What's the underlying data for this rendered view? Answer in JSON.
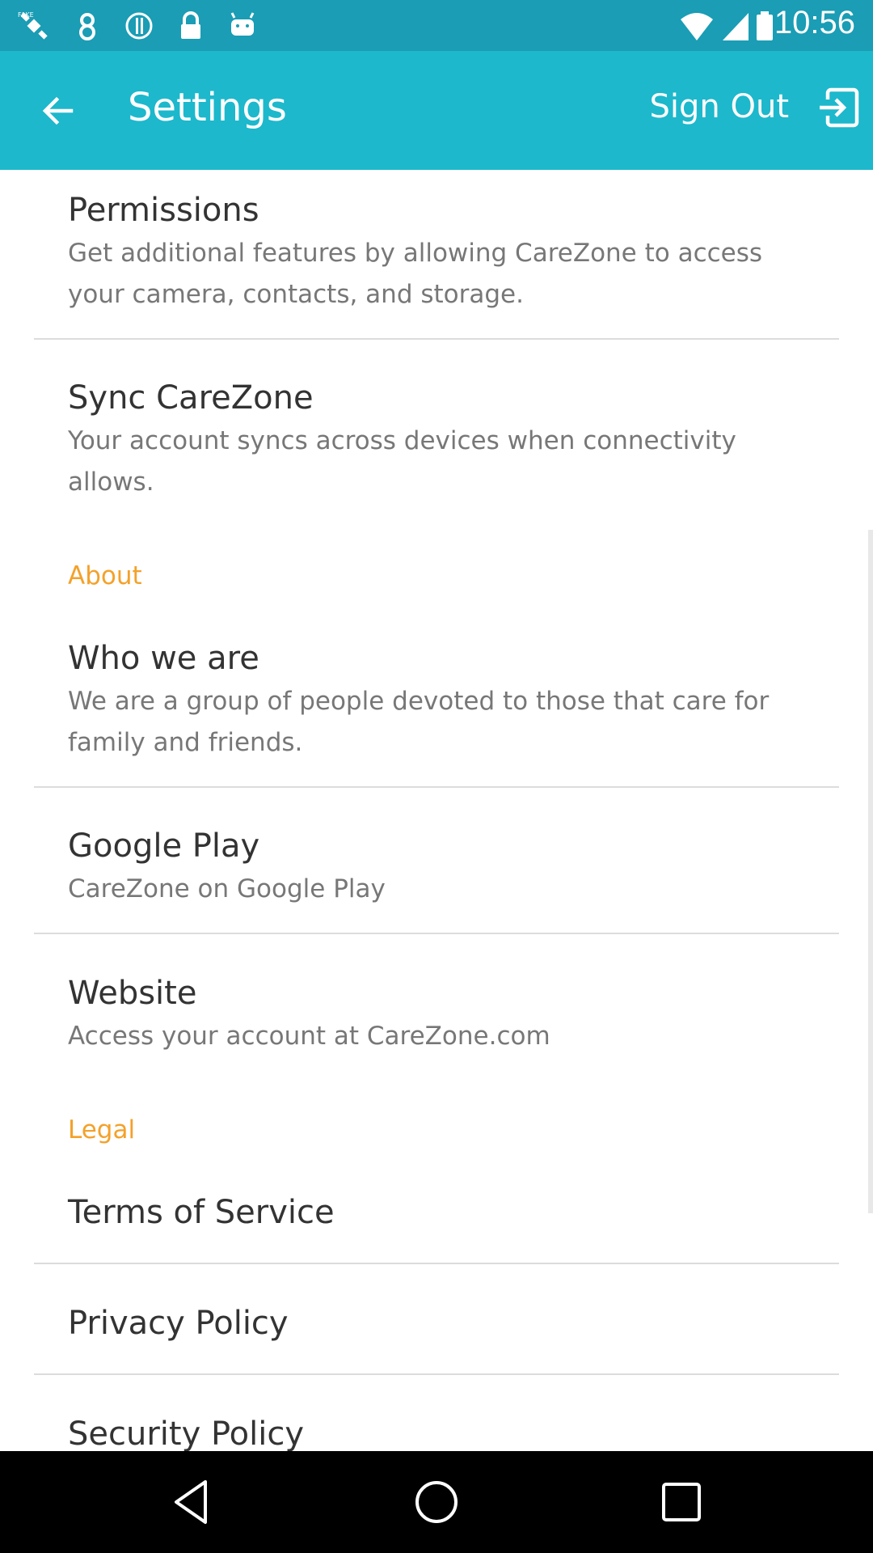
{
  "status_bar": {
    "time": "10:56",
    "icons": [
      "fake-gps-icon",
      "notification-icon",
      "info-icon",
      "lock-icon",
      "android-icon",
      "wifi-icon",
      "signal-icon",
      "battery-icon"
    ]
  },
  "app_bar": {
    "title": "Settings",
    "sign_out_label": "Sign Out",
    "back_icon": "arrow-left-icon",
    "sign_out_icon": "exit-icon"
  },
  "settings": {
    "permissions": {
      "title": "Permissions",
      "subtitle_line1": "Get additional features by allowing CareZone to access",
      "subtitle_line2": "your camera, contacts, and storage."
    },
    "sync": {
      "title": "Sync CareZone",
      "subtitle_line1": "Your account syncs across devices when connectivity",
      "subtitle_line2": "allows."
    }
  },
  "about": {
    "header": "About",
    "who_we_are": {
      "title": "Who we are",
      "subtitle_line1": "We are a group of people devoted to those that care for",
      "subtitle_line2": "family and friends."
    },
    "google_play": {
      "title": "Google Play",
      "subtitle": "CareZone on Google Play"
    },
    "website": {
      "title": "Website",
      "subtitle": "Access your account at CareZone.com"
    }
  },
  "legal": {
    "header": "Legal",
    "terms": "Terms of Service",
    "privacy": "Privacy Policy",
    "security": "Security Policy"
  },
  "colors": {
    "status_bar": "#1a9db5",
    "app_bar": "#1db8cc",
    "section_header": "#f4a12a"
  }
}
